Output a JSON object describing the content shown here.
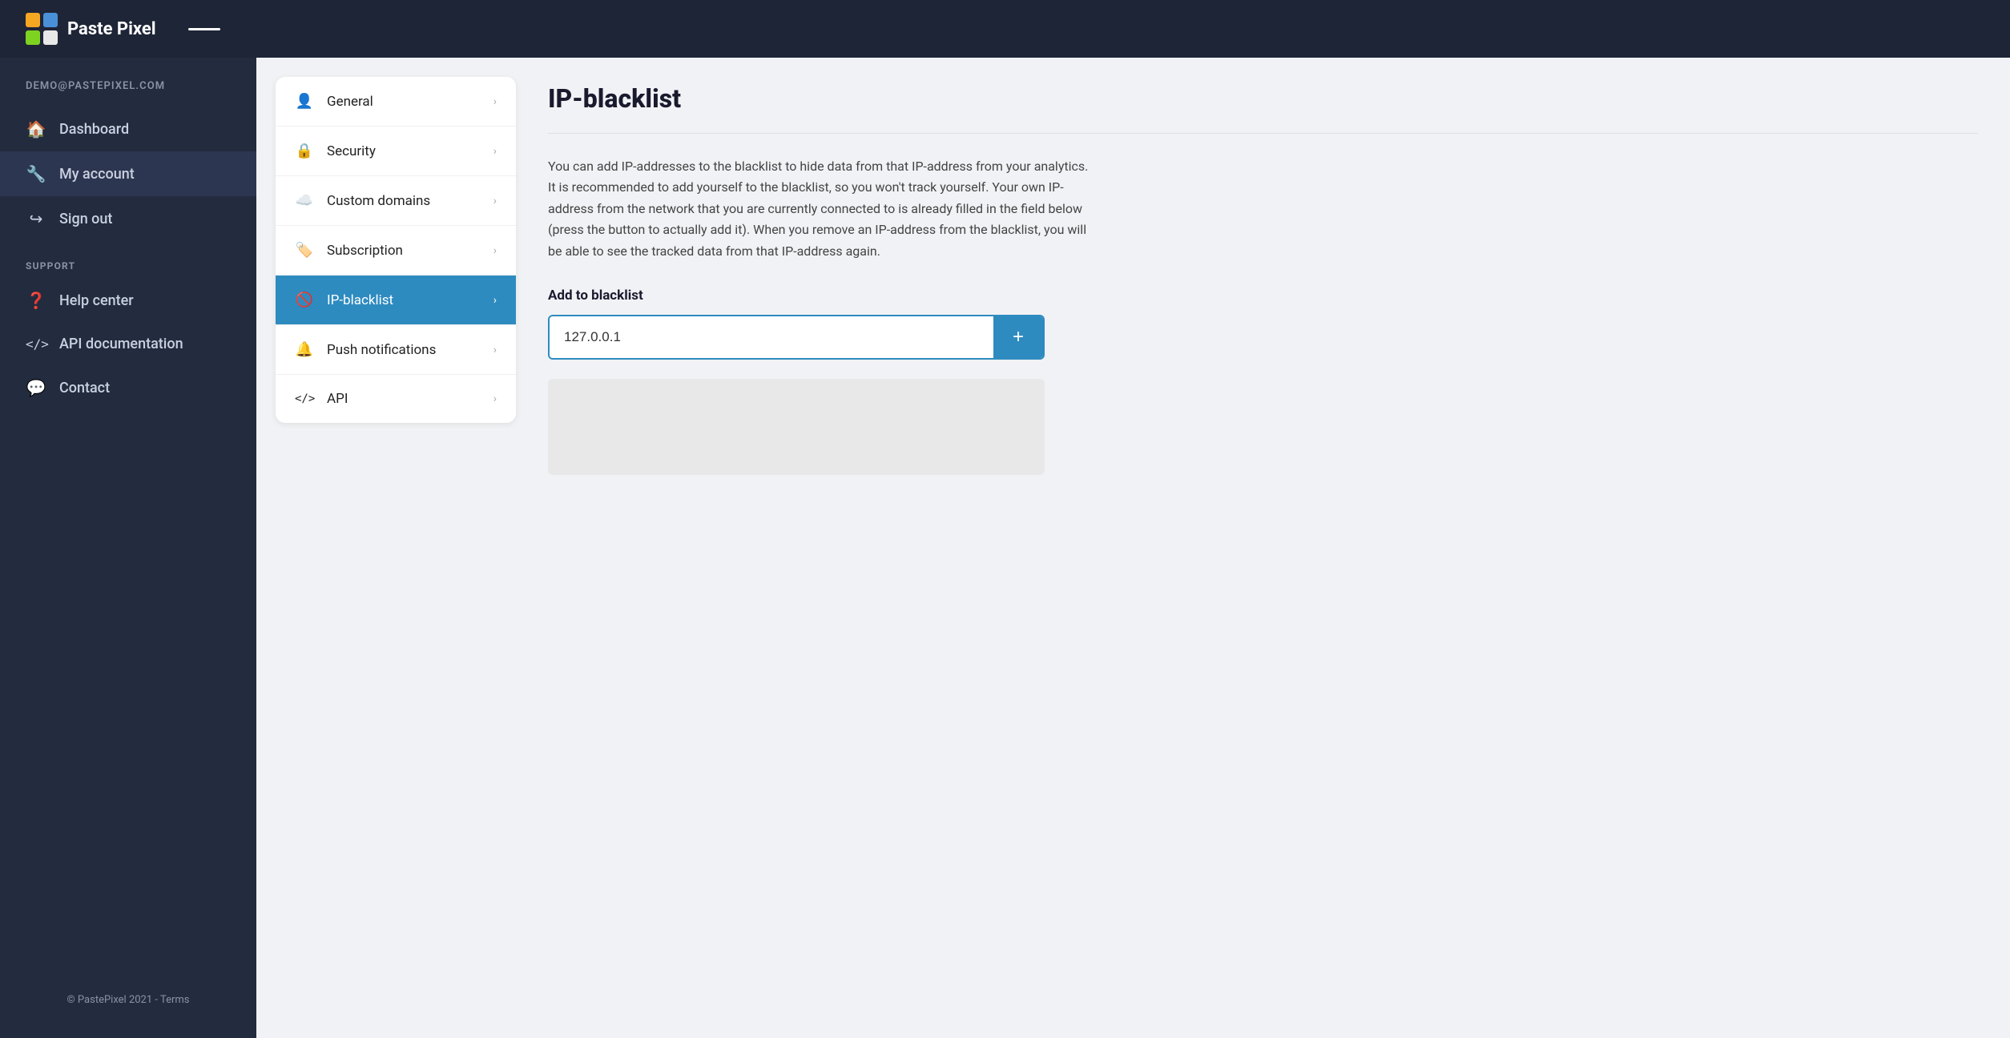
{
  "app": {
    "title": "Paste Pixel",
    "topbar_divider": "—"
  },
  "sidebar": {
    "user_email": "DEMO@PASTEPIXEL.COM",
    "nav_items": [
      {
        "id": "dashboard",
        "label": "Dashboard",
        "icon": "🏠"
      },
      {
        "id": "my-account",
        "label": "My account",
        "icon": "⚙️",
        "active": true
      }
    ],
    "sign_out": {
      "label": "Sign out",
      "icon": "↪"
    },
    "support_label": "SUPPORT",
    "support_items": [
      {
        "id": "help-center",
        "label": "Help center",
        "icon": "❓"
      },
      {
        "id": "api-docs",
        "label": "API documentation",
        "icon": "</>"
      },
      {
        "id": "contact",
        "label": "Contact",
        "icon": "💬"
      }
    ],
    "footer": "© PastePixel 2021 - Terms"
  },
  "settings_menu": {
    "items": [
      {
        "id": "general",
        "label": "General",
        "icon": "👤"
      },
      {
        "id": "security",
        "label": "Security",
        "icon": "🔒"
      },
      {
        "id": "custom-domains",
        "label": "Custom domains",
        "icon": "☁️"
      },
      {
        "id": "subscription",
        "label": "Subscription",
        "icon": "🏷️"
      },
      {
        "id": "ip-blacklist",
        "label": "IP-blacklist",
        "icon": "🚫",
        "active": true
      },
      {
        "id": "push-notifications",
        "label": "Push notifications",
        "icon": "🔔"
      },
      {
        "id": "api",
        "label": "API",
        "icon": "</>"
      }
    ]
  },
  "main_content": {
    "title": "IP-blacklist",
    "description": "You can add IP-addresses to the blacklist to hide data from that IP-address from your analytics. It is recommended to add yourself to the blacklist, so you won't track yourself. Your own IP-address from the network that you are currently connected to is already filled in the field below (press the button to actually add it). When you remove an IP-address from the blacklist, you will be able to see the tracked data from that IP-address again.",
    "add_section_label": "Add to blacklist",
    "input_value": "127.0.0.1",
    "add_button_label": "+"
  }
}
